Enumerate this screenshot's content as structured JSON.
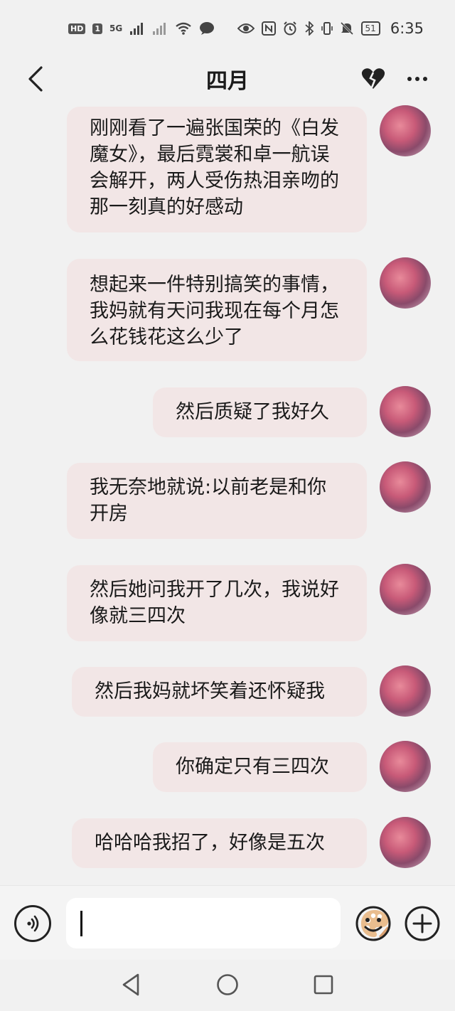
{
  "status_bar": {
    "hd_label": "HD",
    "sim_label": "1",
    "network_label": "5G",
    "battery": "51",
    "time": "6:35",
    "icons": [
      "wifi-icon",
      "chat-icon",
      "eye-icon",
      "nfc-icon",
      "alarm-icon",
      "bluetooth-icon",
      "vibrate-icon",
      "mute-icon"
    ]
  },
  "header": {
    "title": "四月",
    "back_icon": "back-arrow-icon",
    "theme_icon": "broken-heart-icon",
    "more_icon": "more-dots-icon"
  },
  "messages": [
    {
      "text": "刚刚看了一遍张国荣的《白发魔女》，最后霓裳和卓一航误会解开，两人受伤热泪亲吻的那一刻真的好感动",
      "sender": "self"
    },
    {
      "text": "想起来一件特别搞笑的事情，我妈就有天问我现在每个月怎么花钱花这么少了",
      "sender": "self"
    },
    {
      "text": "然后质疑了我好久",
      "sender": "self"
    },
    {
      "text": "我无奈地就说:以前老是和你开房",
      "sender": "self"
    },
    {
      "text": "然后她问我开了几次，我说好像就三四次",
      "sender": "self"
    },
    {
      "text": "然后我妈就坏笑着还怀疑我",
      "sender": "self"
    },
    {
      "text": "你确定只有三四次",
      "sender": "self"
    },
    {
      "text": "哈哈哈我招了，好像是五次",
      "sender": "self"
    }
  ],
  "input_bar": {
    "value": "",
    "icons": [
      "voice-icon",
      "palette-icon",
      "emoji-icon",
      "plus-icon"
    ]
  },
  "nav_bar": {
    "icons": [
      "nav-back-icon",
      "nav-home-icon",
      "nav-recents-icon"
    ]
  },
  "colors": {
    "bubble": "#f2e6e6",
    "background": "#f1f1f1"
  }
}
